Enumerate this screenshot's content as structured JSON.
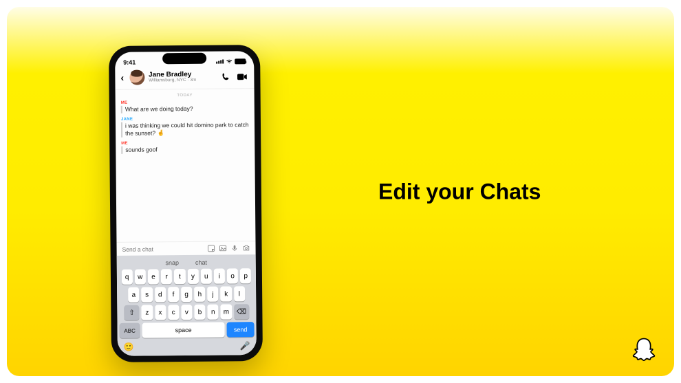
{
  "headline": "Edit your Chats",
  "status": {
    "time": "9:41"
  },
  "header": {
    "name": "Jane Bradley",
    "subtitle": "Williamsburg, NYC · 3m"
  },
  "chat": {
    "date_separator": "TODAY",
    "labels": {
      "me": "ME",
      "other": "JANE"
    },
    "msg1": "What are we doing today?",
    "msg2": "i was thinking we could hit domino park to catch the sunset? 🤞",
    "msg3": "sounds goof"
  },
  "input": {
    "placeholder": "Send a chat"
  },
  "keyboard": {
    "suggestions": [
      "snap",
      "chat"
    ],
    "row1": [
      "q",
      "w",
      "e",
      "r",
      "t",
      "y",
      "u",
      "i",
      "o",
      "p"
    ],
    "row2": [
      "a",
      "s",
      "d",
      "f",
      "g",
      "h",
      "j",
      "k",
      "l"
    ],
    "row3": [
      "z",
      "x",
      "c",
      "v",
      "b",
      "n",
      "m"
    ],
    "shift": "⇧",
    "backspace": "⌫",
    "abc": "ABC",
    "space": "space",
    "send": "send",
    "emoji": "🙂",
    "mic": "🎤"
  }
}
